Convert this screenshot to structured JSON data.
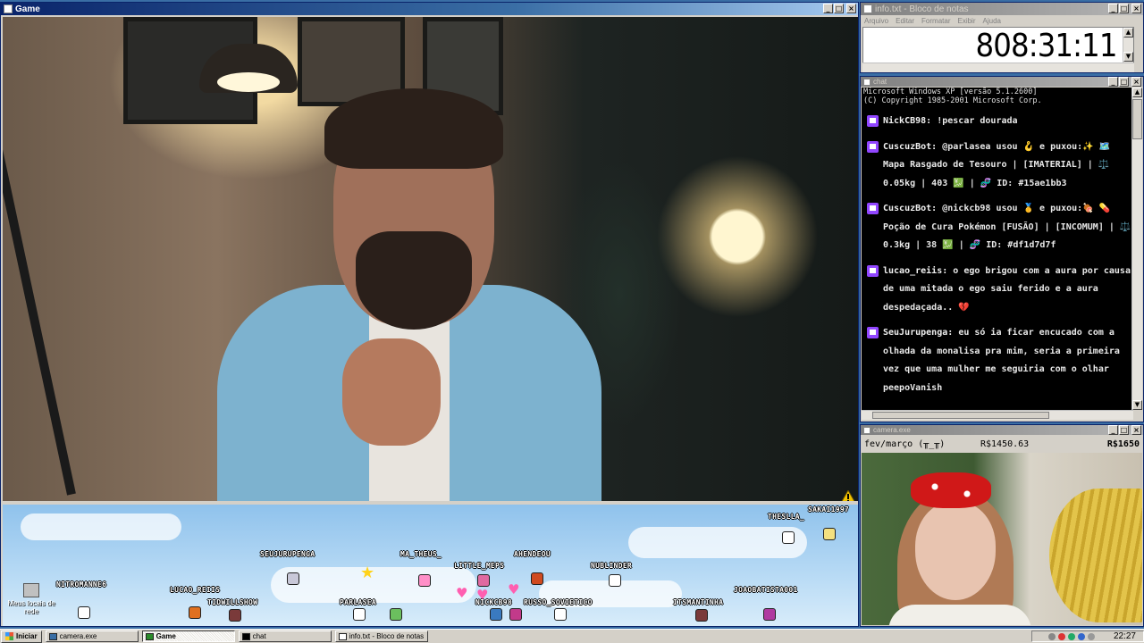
{
  "game_window": {
    "title": "Game",
    "players": [
      {
        "name": "SEUJURUPENGA"
      },
      {
        "name": "MA_THEUS_"
      },
      {
        "name": "AHENDEOU"
      },
      {
        "name": "LITTLE_MEPS"
      },
      {
        "name": "NUBLINDER"
      },
      {
        "name": "THESLLA_"
      },
      {
        "name": "SAKAI1997"
      },
      {
        "name": "NITROMANNE6"
      },
      {
        "name": "LUCAO_REIIS"
      },
      {
        "name": "TIDWILLSHOW"
      },
      {
        "name": "PARLASEA"
      },
      {
        "name": "NICKCB98"
      },
      {
        "name": "RUSSO_SOVIETICO"
      },
      {
        "name": "ITSMANTINHA"
      },
      {
        "name": "JOAOBATISTA001"
      }
    ],
    "desktop_icon_label": "Meus locais de rede"
  },
  "notepad": {
    "title": "info.txt - Bloco de notas",
    "menu": [
      "Arquivo",
      "Editar",
      "Formatar",
      "Exibir",
      "Ajuda"
    ],
    "timer": "808:31:11"
  },
  "chat": {
    "title": "chat",
    "header_lines": [
      "Microsoft Windows XP [versão 5.1.2600]",
      "(C) Copyright 1985-2001 Microsoft Corp."
    ],
    "messages": [
      {
        "user": "NickCB98:",
        "text": "!pescar dourada"
      },
      {
        "user": "CuscuzBot:",
        "text": "@parlasea usou 🪝 e puxou:✨ 🗺️ Mapa Rasgado de Tesouro | [IMATERIAL] | ⚖️ 0.05kg | 403 💹 | 🧬 ID: #15ae1bb3"
      },
      {
        "user": "CuscuzBot:",
        "text": "@nickcb98 usou 🥇 e puxou:🍖 💊 Poção de Cura Pokémon [FUSÃO] | [INCOMUM] | ⚖️ 0.3kg | 38 💹 | 🧬 ID: #df1d7d7f"
      },
      {
        "user": "lucao_reiis:",
        "text": "o ego brigou com a aura por causa de uma mitada o ego saiu ferido e a aura despedaçada.. 💔"
      },
      {
        "user": "SeuJurupenga:",
        "text": "eu só ia ficar encucado com a olhada da monalisa pra mim, seria a primeira vez que uma mulher me seguiria com o olhar peepoVanish"
      }
    ]
  },
  "camera": {
    "title": "camera.exe",
    "goal_label": "fev/março (╥_╥)",
    "goal_current": "R$1450.63",
    "goal_target": "R$1650"
  },
  "taskbar": {
    "start_label": "Iniciar",
    "tasks": [
      {
        "label": "camera.exe"
      },
      {
        "label": "Game"
      },
      {
        "label": "chat"
      },
      {
        "label": "info.txt - Bloco de notas"
      }
    ],
    "clock": "22:27"
  }
}
